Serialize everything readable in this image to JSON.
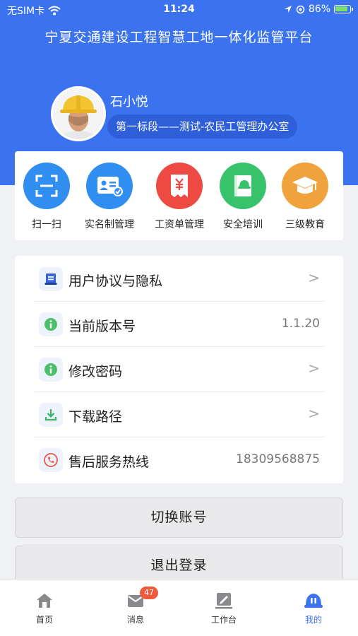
{
  "status_bar": {
    "carrier": "无SIM卡",
    "time": "11:24",
    "battery": "86%"
  },
  "header": {
    "title": "宁夏交通建设工程智慧工地一体化监管平台"
  },
  "user": {
    "name": "石小悦",
    "org": "第一标段——测试-农民工管理办公室"
  },
  "quick_actions": [
    {
      "label": "扫一扫",
      "icon": "scan-icon",
      "color": "#2f8ef0"
    },
    {
      "label": "实名制管理",
      "icon": "id-card-icon",
      "color": "#2f8ef0"
    },
    {
      "label": "工资单管理",
      "icon": "payroll-icon",
      "color": "#ee4a44"
    },
    {
      "label": "安全培训",
      "icon": "helmet-book-icon",
      "color": "#39c26c"
    },
    {
      "label": "三级教育",
      "icon": "graduation-cap-icon",
      "color": "#f0a23c"
    }
  ],
  "menu": [
    {
      "label": "用户协议与隐私",
      "value": "",
      "icon": "document-icon"
    },
    {
      "label": "当前版本号",
      "value": "1.1.20",
      "icon": "info-icon"
    },
    {
      "label": "修改密码",
      "value": "",
      "icon": "info-icon"
    },
    {
      "label": "下载路径",
      "value": "",
      "icon": "download-icon"
    },
    {
      "label": "售后服务热线",
      "value": "18309568875",
      "icon": "phone-icon"
    }
  ],
  "chevron": ">",
  "buttons": {
    "switch_account": "切换账号",
    "logout": "退出登录"
  },
  "tabs": [
    {
      "label": "首页",
      "icon": "home-icon"
    },
    {
      "label": "消息",
      "icon": "message-icon",
      "badge": "47"
    },
    {
      "label": "工作台",
      "icon": "workbench-icon"
    },
    {
      "label": "我的",
      "icon": "profile-icon"
    }
  ],
  "colors": {
    "primary": "#3a72f0",
    "badge": "#ee5a3d"
  }
}
